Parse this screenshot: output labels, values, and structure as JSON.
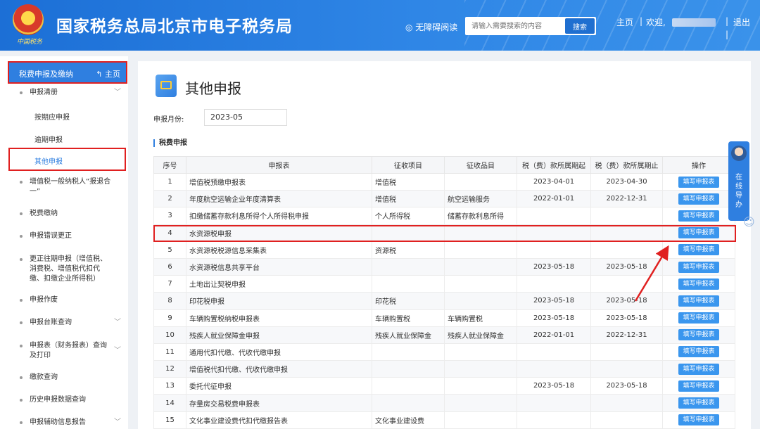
{
  "header": {
    "emblem_sub": "中国税务",
    "title": "国家税务总局北京市电子税务局",
    "a11y": "◎ 无障碍阅读",
    "search_placeholder": "请输入需要搜索的内容",
    "search_button": "搜索",
    "home": "主页",
    "sep": "|",
    "welcome": "欢迎,",
    "logout": "退出"
  },
  "sidebar": {
    "head_title": "税费申报及缴纳",
    "head_home": "↰ 主页",
    "items": [
      {
        "label": "申报清册",
        "chevron": "﹀"
      },
      {
        "label": "增值税一般纳税人“报退合一”",
        "chevron": ""
      },
      {
        "label": "税费缴纳",
        "chevron": ""
      },
      {
        "label": "申报错误更正",
        "chevron": ""
      },
      {
        "label": "更正往期申报（增值税、消费税、增值税代扣代缴、扣缴企业所得税）",
        "chevron": ""
      },
      {
        "label": "申报作废",
        "chevron": ""
      },
      {
        "label": "申报台账查询",
        "chevron": "﹀"
      },
      {
        "label": "申报表（财务报表）查询及打印",
        "chevron": "﹀"
      },
      {
        "label": "缴款查询",
        "chevron": ""
      },
      {
        "label": "历史申报数据查询",
        "chevron": ""
      },
      {
        "label": "申报辅助信息报告",
        "chevron": "﹀"
      }
    ],
    "sub_items": [
      "按期应申报",
      "逾期申报",
      "其他申报"
    ]
  },
  "main": {
    "title": "其他申报",
    "month_label": "申报月份:",
    "month_value": "2023-05",
    "section_title": "税费申报",
    "columns": [
      "序号",
      "申报表",
      "征收项目",
      "征收品目",
      "税（费）款所属期起",
      "税（费）款所属期止",
      "操作"
    ],
    "action_label": "填写申报表",
    "rows": [
      [
        "1",
        "增值税预缴申报表",
        "增值税",
        "",
        "2023-04-01",
        "2023-04-30"
      ],
      [
        "2",
        "年度航空运输企业年度清算表",
        "增值税",
        "航空运输服务",
        "2022-01-01",
        "2022-12-31"
      ],
      [
        "3",
        "扣缴储蓄存款利息所得个人所得税申报",
        "个人所得税",
        "储蓄存款利息所得",
        "",
        ""
      ],
      [
        "4",
        "水资源税申报",
        "",
        "",
        "",
        ""
      ],
      [
        "5",
        "水资源税税源信息采集表",
        "资源税",
        "",
        "",
        ""
      ],
      [
        "6",
        "水资源税信息共享平台",
        "",
        "",
        "2023-05-18",
        "2023-05-18"
      ],
      [
        "7",
        "土地出让契税申报",
        "",
        "",
        "",
        ""
      ],
      [
        "8",
        "印花税申报",
        "印花税",
        "",
        "2023-05-18",
        "2023-05-18"
      ],
      [
        "9",
        "车辆购置税纳税申报表",
        "车辆购置税",
        "车辆购置税",
        "2023-05-18",
        "2023-05-18"
      ],
      [
        "10",
        "残疾人就业保障金申报",
        "残疾人就业保障金",
        "残疾人就业保障金",
        "2022-01-01",
        "2022-12-31"
      ],
      [
        "11",
        "通用代扣代缴、代收代缴申报",
        "",
        "",
        "",
        ""
      ],
      [
        "12",
        "增值税代扣代缴、代收代缴申报",
        "",
        "",
        "",
        ""
      ],
      [
        "13",
        "委托代征申报",
        "",
        "",
        "2023-05-18",
        "2023-05-18"
      ],
      [
        "14",
        "存量房交易税费申报表",
        "",
        "",
        "",
        ""
      ],
      [
        "15",
        "文化事业建设费代扣代缴报告表",
        "文化事业建设费",
        "",
        "",
        ""
      ]
    ]
  },
  "online_help": "在线导办",
  "colors": {
    "brand": "#2f7fe0",
    "highlight": "#e02020",
    "button": "#3a96ee"
  }
}
